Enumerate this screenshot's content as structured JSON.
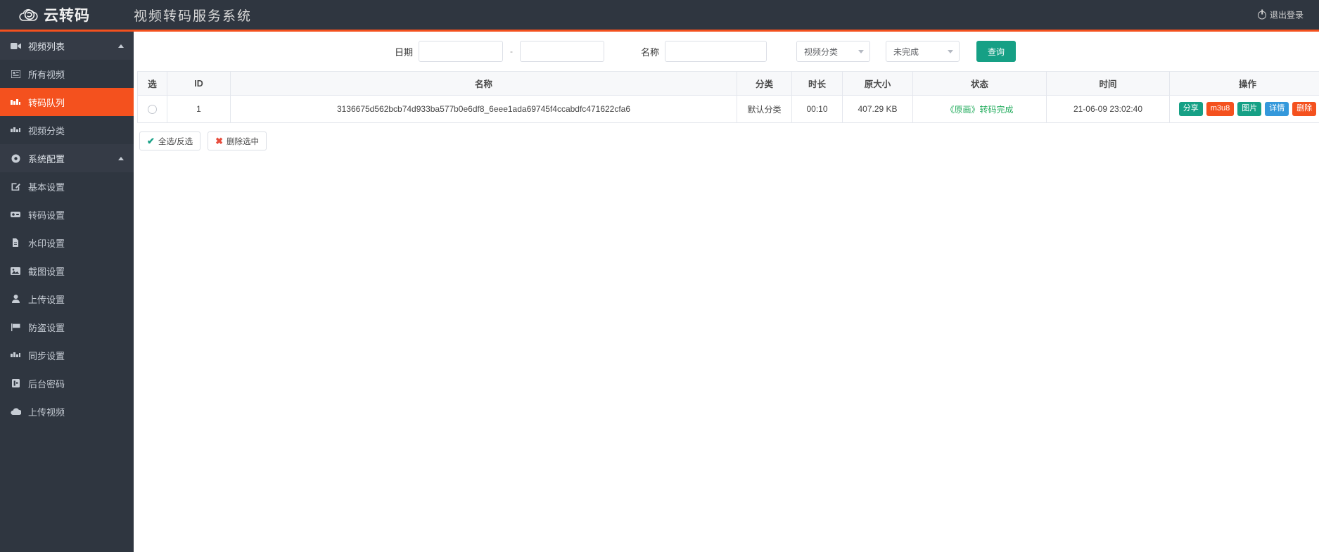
{
  "header": {
    "brand_text": "云转码",
    "app_title": "视频转码服务系统",
    "logout_label": "退出登录",
    "logout_icon": "power-icon",
    "bg_color": "#2f3640",
    "accent_color": "#f4511e"
  },
  "sidebar": {
    "items": [
      {
        "label": "视频列表",
        "icon": "video-camera-icon",
        "type": "group",
        "active": false,
        "caret": true
      },
      {
        "label": "所有视频",
        "icon": "list-icon",
        "type": "sub",
        "active": false,
        "caret": false
      },
      {
        "label": "转码队列",
        "icon": "queue-icon",
        "type": "sub",
        "active": true,
        "caret": false
      },
      {
        "label": "视频分类",
        "icon": "category-icon",
        "type": "sub",
        "active": false,
        "caret": false
      },
      {
        "label": "系统配置",
        "icon": "gear-icon",
        "type": "group",
        "active": false,
        "caret": true
      },
      {
        "label": "基本设置",
        "icon": "edit-icon",
        "type": "sub",
        "active": false,
        "caret": false
      },
      {
        "label": "转码设置",
        "icon": "transcode-icon",
        "type": "sub",
        "active": false,
        "caret": false
      },
      {
        "label": "水印设置",
        "icon": "watermark-icon",
        "type": "sub",
        "active": false,
        "caret": false
      },
      {
        "label": "截图设置",
        "icon": "image-icon",
        "type": "sub",
        "active": false,
        "caret": false
      },
      {
        "label": "上传设置",
        "icon": "user-icon",
        "type": "sub",
        "active": false,
        "caret": false
      },
      {
        "label": "防盗设置",
        "icon": "flag-icon",
        "type": "sub",
        "active": false,
        "caret": false
      },
      {
        "label": "同步设置",
        "icon": "sync-icon",
        "type": "sub",
        "active": false,
        "caret": false
      },
      {
        "label": "后台密码",
        "icon": "password-icon",
        "type": "sub",
        "active": false,
        "caret": false
      },
      {
        "label": "上传视频",
        "icon": "cloud-upload-icon",
        "type": "sub",
        "active": false,
        "caret": false
      }
    ]
  },
  "filter": {
    "date_label": "日期",
    "date_start_value": "",
    "date_start_placeholder": "",
    "date_separator": "-",
    "date_end_value": "",
    "date_end_placeholder": "",
    "name_label": "名称",
    "name_value": "",
    "name_placeholder": "",
    "category_select": "视频分类",
    "status_select": "未完成",
    "search_button": "查询",
    "search_button_color": "#16a085"
  },
  "table": {
    "columns": [
      "选",
      "ID",
      "名称",
      "分类",
      "时长",
      "原大小",
      "状态",
      "时间",
      "操作"
    ],
    "rows": [
      {
        "id": "1",
        "name": "3136675d562bcb74d933ba577b0e6df8_6eee1ada69745f4ccabdfc471622cfa6",
        "category": "默认分类",
        "duration": "00:10",
        "size": "407.29 KB",
        "status": "《原画》转码完成",
        "time": "21-06-09 23:02:40",
        "actions": [
          {
            "label": "分享",
            "color": "#16a085"
          },
          {
            "label": "m3u8",
            "color": "#f4511e"
          },
          {
            "label": "图片",
            "color": "#16a085"
          },
          {
            "label": "详情",
            "color": "#3498db"
          },
          {
            "label": "删除",
            "color": "#f4511e"
          }
        ]
      }
    ]
  },
  "bulk": {
    "select_all_label": "全选/反选",
    "select_all_icon": "check-icon",
    "delete_selected_label": "删除选中",
    "delete_selected_icon": "cross-icon"
  }
}
